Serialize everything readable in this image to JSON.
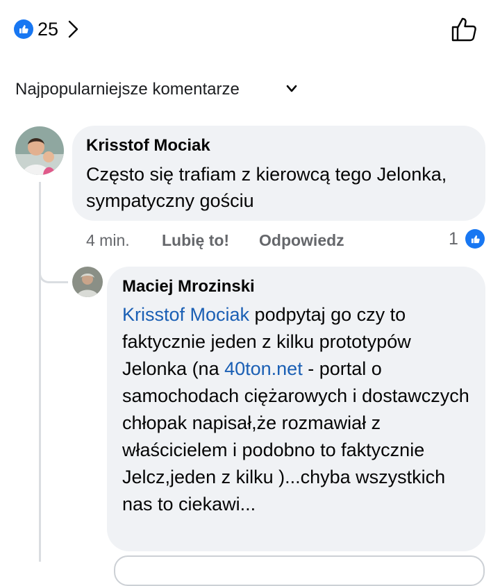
{
  "reactions": {
    "count": "25",
    "icon": "thumbs-up-icon"
  },
  "sort": {
    "label": "Najpopularniejsze komentarze"
  },
  "comment": {
    "author": "Krisstof Mociak",
    "text": "Często się trafiam z kierowcą tego Jelonka, sympatyczny gościu",
    "time": "4 min.",
    "like_label": "Lubię to!",
    "reply_label": "Odpowiedz",
    "reaction_count": "1"
  },
  "reply": {
    "author": "Maciej Mrozinski",
    "mention": "Krisstof Mociak",
    "text_part1": " podpytaj go czy to faktycznie jeden z kilku prototypów Jelonka (na ",
    "link": "40ton.net",
    "text_part2": " - portal o samochodach ciężarowych i dostawczych chłopak napisał,że rozmawiał z właścicielem i podobno to faktycznie Jelcz,jeden z kilku )...chyba wszystkich nas to ciekawi..."
  },
  "colors": {
    "accent": "#1877f2",
    "bubble": "#f0f2f5",
    "meta": "#65676b",
    "link": "#1a5fb4"
  }
}
